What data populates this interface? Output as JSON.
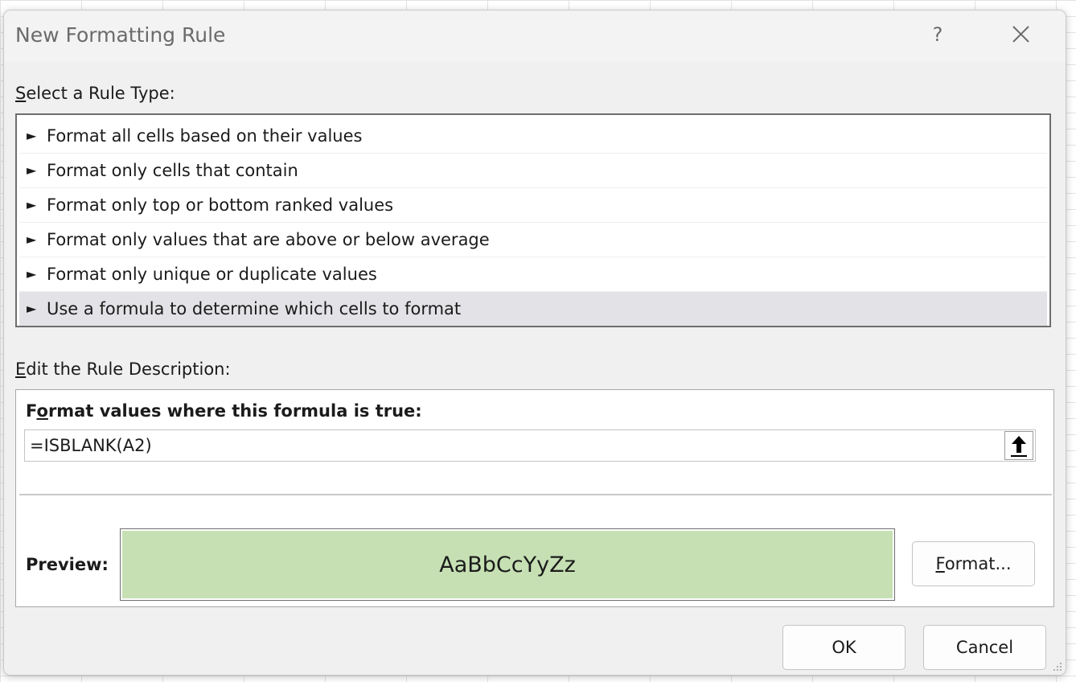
{
  "dialog": {
    "title": "New Formatting Rule",
    "help_glyph": "?",
    "help_icon": "help-icon",
    "close_icon": "close-icon"
  },
  "rule_type": {
    "label_first": "S",
    "label_rest": "elect a Rule Type:",
    "arrow_glyph": "►",
    "items": [
      {
        "label": "Format all cells based on their values",
        "selected": false
      },
      {
        "label": "Format only cells that contain",
        "selected": false
      },
      {
        "label": "Format only top or bottom ranked values",
        "selected": false
      },
      {
        "label": "Format only values that are above or below average",
        "selected": false
      },
      {
        "label": "Format only unique or duplicate values",
        "selected": false
      },
      {
        "label": "Use a formula to determine which cells to format",
        "selected": true
      }
    ]
  },
  "description": {
    "label_first": "E",
    "label_rest": "dit the Rule Description:",
    "formula_heading_a": "F",
    "formula_heading_u": "o",
    "formula_heading_b": "rmat values where this formula is true:",
    "formula_value": "=ISBLANK(A2)",
    "collapse_icon": "arrow-up-icon",
    "preview_label": "Preview:",
    "preview_text": "AaBbCcYyZz",
    "preview_fill": "#c6e0b4",
    "format_button_first": "F",
    "format_button_rest": "ormat..."
  },
  "buttons": {
    "ok": "OK",
    "cancel": "Cancel"
  },
  "colors": {
    "dialog_bg": "#f0f0f0",
    "selected_row": "#e3e3e7"
  }
}
